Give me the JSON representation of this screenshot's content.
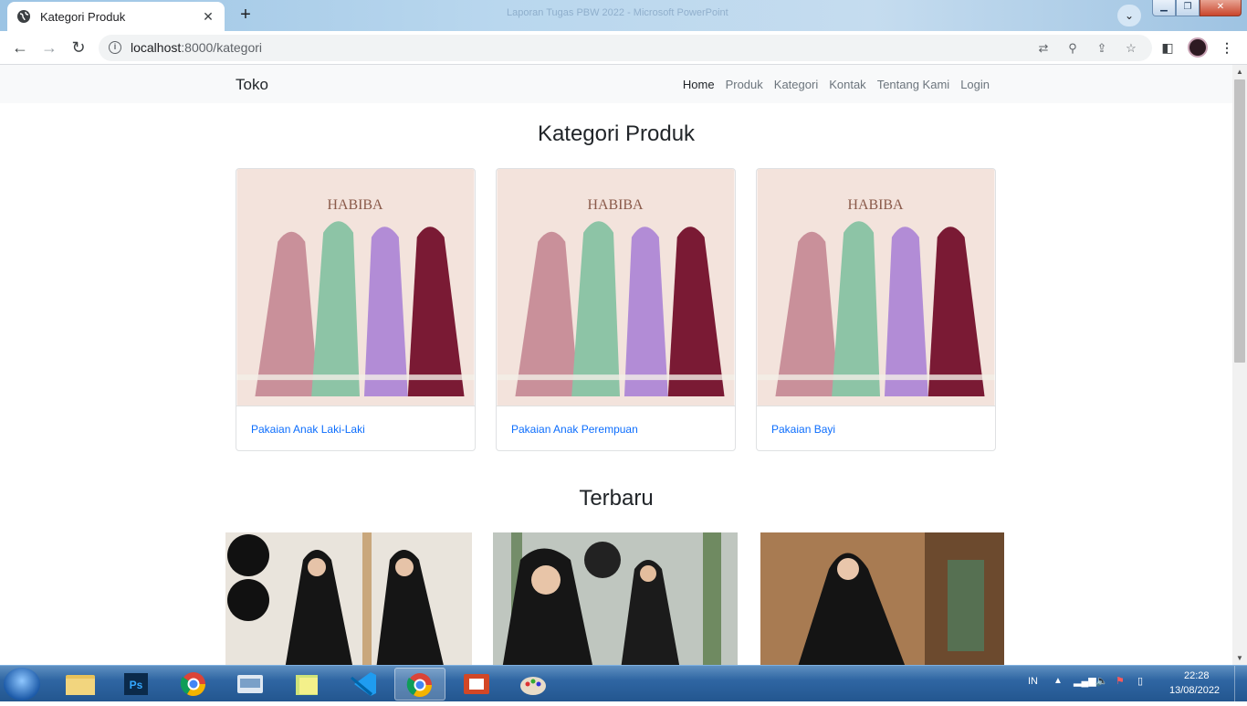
{
  "browser": {
    "tab_title": "Kategori Produk",
    "tab_close": "✕",
    "new_tab": "+",
    "window_title": "Laporan Tugas PBW 2022 - Microsoft PowerPoint",
    "url_host": "localhost",
    "url_path": ":8000/kategori"
  },
  "navbar": {
    "brand": "Toko",
    "links": [
      "Home",
      "Produk",
      "Kategori",
      "Kontak",
      "Tentang Kami",
      "Login"
    ],
    "active": "Home"
  },
  "main": {
    "kategori_title": "Kategori Produk",
    "categories": [
      {
        "name": "Pakaian Anak Laki-Laki",
        "image_caption": "HABIBA"
      },
      {
        "name": "Pakaian Anak Perempuan",
        "image_caption": "HABIBA"
      },
      {
        "name": "Pakaian Bayi",
        "image_caption": "HABIBA"
      }
    ],
    "terbaru_title": "Terbaru"
  },
  "taskbar": {
    "language": "IN",
    "time": "22:28",
    "date": "13/08/2022"
  },
  "colors": {
    "link": "#0d6efd",
    "navbar_bg": "#f8f9fa",
    "taskbar": "#2f66a3"
  }
}
